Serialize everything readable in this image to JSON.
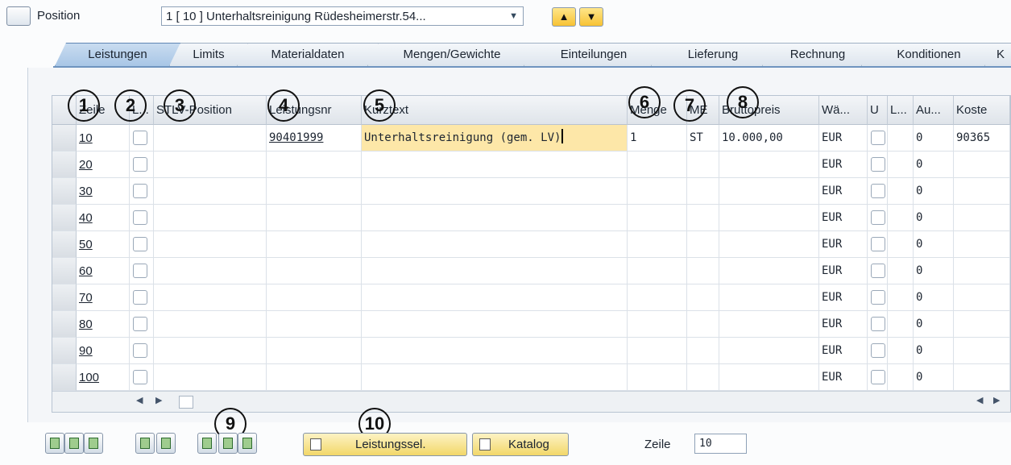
{
  "header": {
    "position_label": "Position",
    "position_value": "1 [ 10 ] Unterhaltsreinigung Rüdesheimerstr.54...",
    "prev_icon": "arrow-up-icon",
    "next_icon": "arrow-down-icon"
  },
  "tabs": [
    {
      "label": "Leistungen",
      "active": true
    },
    {
      "label": "Limits"
    },
    {
      "label": "Materialdaten"
    },
    {
      "label": "Mengen/Gewichte"
    },
    {
      "label": "Einteilungen"
    },
    {
      "label": "Lieferung"
    },
    {
      "label": "Rechnung"
    },
    {
      "label": "Konditionen"
    },
    {
      "label": "K"
    }
  ],
  "table": {
    "columns": [
      "Zeile",
      "L...",
      "STLV-Position",
      "Leistungsnr",
      "Kurztext",
      "Menge",
      "ME",
      "Bruttopreis",
      "Wä...",
      "U",
      "L...",
      "Au...",
      "Koste"
    ],
    "rows": [
      {
        "zeile": "10",
        "leistungsnr": "90401999",
        "kurztext": "Unterhaltsreinigung (gem. LV)",
        "menge": "1",
        "me": "ST",
        "bruttopreis": "10.000,00",
        "waehrung": "EUR",
        "au": "0",
        "koste": "90365"
      },
      {
        "zeile": "20",
        "leistungsnr": "",
        "kurztext": "",
        "menge": "",
        "me": "",
        "bruttopreis": "",
        "waehrung": "EUR",
        "au": "0",
        "koste": ""
      },
      {
        "zeile": "30",
        "leistungsnr": "",
        "kurztext": "",
        "menge": "",
        "me": "",
        "bruttopreis": "",
        "waehrung": "EUR",
        "au": "0",
        "koste": ""
      },
      {
        "zeile": "40",
        "leistungsnr": "",
        "kurztext": "",
        "menge": "",
        "me": "",
        "bruttopreis": "",
        "waehrung": "EUR",
        "au": "0",
        "koste": ""
      },
      {
        "zeile": "50",
        "leistungsnr": "",
        "kurztext": "",
        "menge": "",
        "me": "",
        "bruttopreis": "",
        "waehrung": "EUR",
        "au": "0",
        "koste": ""
      },
      {
        "zeile": "60",
        "leistungsnr": "",
        "kurztext": "",
        "menge": "",
        "me": "",
        "bruttopreis": "",
        "waehrung": "EUR",
        "au": "0",
        "koste": ""
      },
      {
        "zeile": "70",
        "leistungsnr": "",
        "kurztext": "",
        "menge": "",
        "me": "",
        "bruttopreis": "",
        "waehrung": "EUR",
        "au": "0",
        "koste": ""
      },
      {
        "zeile": "80",
        "leistungsnr": "",
        "kurztext": "",
        "menge": "",
        "me": "",
        "bruttopreis": "",
        "waehrung": "EUR",
        "au": "0",
        "koste": ""
      },
      {
        "zeile": "90",
        "leistungsnr": "",
        "kurztext": "",
        "menge": "",
        "me": "",
        "bruttopreis": "",
        "waehrung": "EUR",
        "au": "0",
        "koste": ""
      },
      {
        "zeile": "100",
        "leistungsnr": "",
        "kurztext": "",
        "menge": "",
        "me": "",
        "bruttopreis": "",
        "waehrung": "EUR",
        "au": "0",
        "koste": ""
      }
    ]
  },
  "markers": [
    "1",
    "2",
    "3",
    "4",
    "5",
    "6",
    "7",
    "8",
    "9",
    "10"
  ],
  "toolbar": {
    "icons": [
      "details-icon",
      "select-all-icon",
      "deselect-all-icon",
      "insert-row-icon",
      "delete-row-icon",
      "calculator-icon",
      "copy-icon",
      "person-icon"
    ],
    "leistungssel_label": "Leistungssel.",
    "katalog_label": "Katalog",
    "zeile_label": "Zeile",
    "zeile_value": "10"
  }
}
